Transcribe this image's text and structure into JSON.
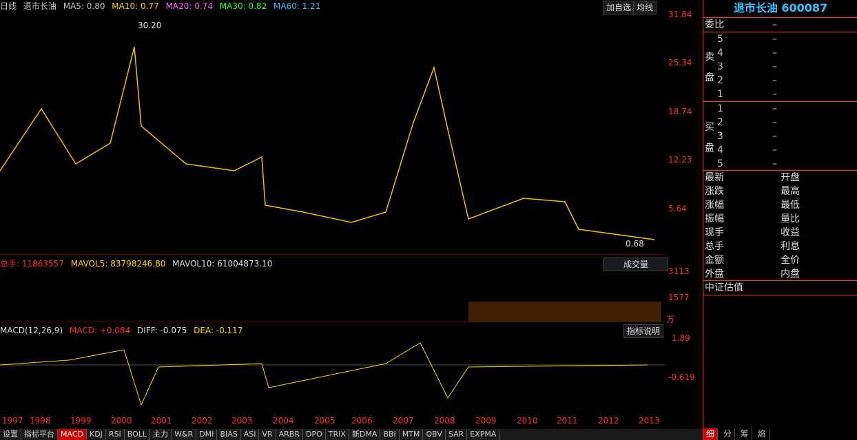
{
  "header": {
    "period": "日线",
    "name": "退市长油",
    "ma5": "MA5: 0.80",
    "ma10": "MA10: 0.77",
    "ma20": "MA20: 0.74",
    "ma30": "MA30: 0.82",
    "ma60": "MA60: 1.21",
    "btn_add": "加自选",
    "btn_ma": "均线"
  },
  "price_axis": [
    "31.84",
    "25.34",
    "18.74",
    "12.23",
    "5.64"
  ],
  "max_label": "30.20",
  "min_label": "0.68",
  "volume": {
    "summary": "总手: 11863557",
    "mavol5": "MAVOL5: 83798246.80",
    "mavol10": "MAVOL10: 61004873.10",
    "dropdown": "成交量",
    "axis": [
      "3113",
      "1577"
    ],
    "unit": "万"
  },
  "macd": {
    "title": "MACD(12,26,9)",
    "macd": "MACD: +0.084",
    "diff": "DIFF: -0.075",
    "dea": "DEA: -0.117",
    "btn": "指标说明",
    "axis": [
      "1.89",
      "-0.619"
    ]
  },
  "years": [
    "1997",
    "1998",
    "1999",
    "2000",
    "2001",
    "2002",
    "2003",
    "2004",
    "2005",
    "2006",
    "2007",
    "2008",
    "2009",
    "2010",
    "2011",
    "2012",
    "2013"
  ],
  "tabs": [
    "设置",
    "指标平台",
    "MACD",
    "KDJ",
    "RSI",
    "BOLL",
    "主力",
    "W&R",
    "DMI",
    "BIAS",
    "ASI",
    "VR",
    "ARBR",
    "DPO",
    "TRIX",
    "新DMA",
    "BBI",
    "MTM",
    "OBV",
    "SAR",
    "EXPMA"
  ],
  "right": {
    "title": "退市长油 600087",
    "weibi": "委比",
    "sell_label": [
      "卖",
      "盘"
    ],
    "buy_label": [
      "买",
      "盘"
    ],
    "sell_levels": [
      "5",
      "4",
      "3",
      "2",
      "1"
    ],
    "buy_levels": [
      "1",
      "2",
      "3",
      "4",
      "5"
    ],
    "dash": "–",
    "left_stats": [
      "最新",
      "涨跌",
      "涨幅",
      "振幅",
      "现手",
      "总手",
      "金额",
      "外盘"
    ],
    "right_stats": [
      "开盘",
      "最高",
      "最低",
      "量比",
      "收益",
      "利息",
      "全价",
      "内盘"
    ],
    "footer_item": "中证估值",
    "bottom_tabs": [
      "细",
      "分",
      "筹",
      "焰"
    ]
  }
}
